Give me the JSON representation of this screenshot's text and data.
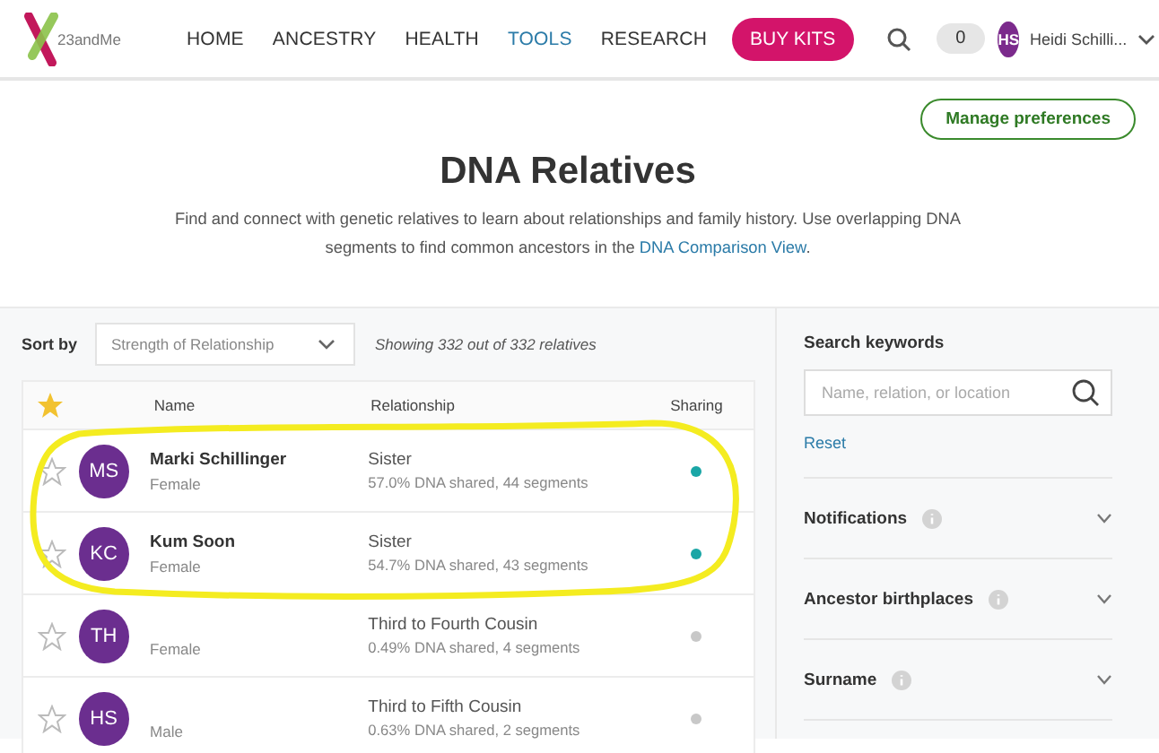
{
  "header": {
    "logo_text": "23andMe",
    "nav": [
      {
        "label": "HOME",
        "selected": false
      },
      {
        "label": "ANCESTRY",
        "selected": false
      },
      {
        "label": "HEALTH",
        "selected": false
      },
      {
        "label": "TOOLS",
        "selected": true
      },
      {
        "label": "RESEARCH",
        "selected": false
      }
    ],
    "buy_button": "BUY KITS",
    "notification_count": "0",
    "user_initials": "HS",
    "user_name": "Heidi Schilli..."
  },
  "manage_button": "Manage preferences",
  "title": "DNA Relatives",
  "description": "Find and connect with genetic relatives to learn about relationships and family history. Use overlapping DNA segments to find common ancestors in the ",
  "description_link": "DNA Comparison View",
  "description_end": ".",
  "sort": {
    "label": "Sort by",
    "value": "Strength of Relationship",
    "summary": "Showing 332 out of 332 relatives"
  },
  "table": {
    "columns": [
      "Name",
      "Relationship",
      "Sharing"
    ],
    "rows": [
      {
        "initials": "MS",
        "name": "Marki Schillinger",
        "sex": "Female",
        "relationship": "Sister",
        "detail": "57.0% DNA shared, 44 segments",
        "starred": false,
        "color": "#1aa6a6"
      },
      {
        "initials": "KC",
        "name": "Kum Soon",
        "sex": "Female",
        "relationship": "Sister",
        "detail": "54.7% DNA shared, 43 segments",
        "starred": false,
        "color": "#1aa6a6"
      },
      {
        "initials": "TH",
        "sex": "Female",
        "relationship": "Third to Fourth Cousin",
        "detail": "0.49% DNA shared, 4 segments",
        "starred": false,
        "color": "#c8c8c8"
      },
      {
        "initials": "HS",
        "sex": "Male",
        "relationship": "Third to Fifth Cousin",
        "detail": "0.63% DNA shared, 2 segments",
        "starred": false,
        "color": "#c8c8c8"
      }
    ]
  },
  "annotation": {
    "kind": "loop"
  },
  "filters": {
    "search_label": "Search keywords",
    "placeholder": "Name, relation, or location",
    "reset": "Reset",
    "sections": [
      {
        "label": "Notifications",
        "expanded": false
      },
      {
        "label": "Ancestor birthplaces",
        "expanded": false
      },
      {
        "label": "Surname",
        "expanded": false
      }
    ]
  }
}
